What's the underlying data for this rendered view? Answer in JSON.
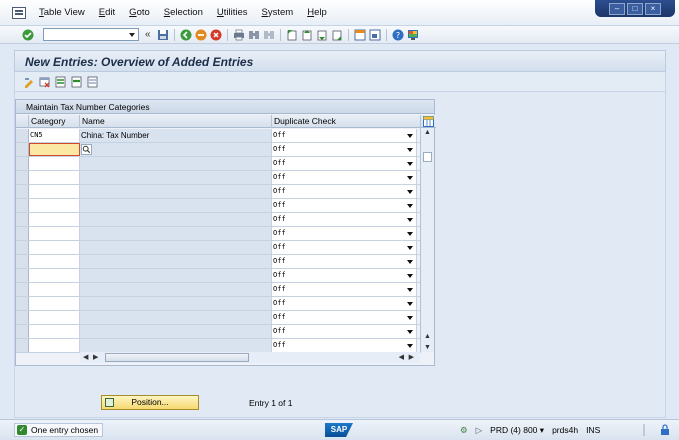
{
  "menubar": {
    "items": [
      "Table View",
      "Edit",
      "Goto",
      "Selection",
      "Utilities",
      "System",
      "Help"
    ]
  },
  "window_controls": [
    "minimize",
    "restore",
    "close"
  ],
  "toolbar": {
    "command_field_value": "",
    "icons": [
      "enter-icon",
      "save-icon",
      "back-icon",
      "exit-icon",
      "cancel-icon",
      "print-icon",
      "find-icon",
      "find-next-icon",
      "first-page-icon",
      "prev-page-icon",
      "next-page-icon",
      "last-page-icon",
      "new-session-icon",
      "shortcut-icon",
      "help-icon",
      "layout-icon"
    ]
  },
  "title": "New Entries: Overview of Added Entries",
  "app_toolbar": {
    "icons": [
      "change-display-icon",
      "delete-icon",
      "select-all-icon",
      "select-block-icon",
      "deselect-all-icon"
    ]
  },
  "table": {
    "title": "Maintain Tax Number Categories",
    "columns": [
      "Category",
      "Name",
      "Duplicate Check"
    ],
    "rows": [
      {
        "category": "CN5",
        "name": "China: Tax Number",
        "duplicate_check": "Off"
      },
      {
        "category": "",
        "name": "",
        "duplicate_check": "Off"
      },
      {
        "category": "",
        "name": "",
        "duplicate_check": "Off"
      },
      {
        "category": "",
        "name": "",
        "duplicate_check": "Off"
      },
      {
        "category": "",
        "name": "",
        "duplicate_check": "Off"
      },
      {
        "category": "",
        "name": "",
        "duplicate_check": "Off"
      },
      {
        "category": "",
        "name": "",
        "duplicate_check": "Off"
      },
      {
        "category": "",
        "name": "",
        "duplicate_check": "Off"
      },
      {
        "category": "",
        "name": "",
        "duplicate_check": "Off"
      },
      {
        "category": "",
        "name": "",
        "duplicate_check": "Off"
      },
      {
        "category": "",
        "name": "",
        "duplicate_check": "Off"
      },
      {
        "category": "",
        "name": "",
        "duplicate_check": "Off"
      },
      {
        "category": "",
        "name": "",
        "duplicate_check": "Off"
      },
      {
        "category": "",
        "name": "",
        "duplicate_check": "Off"
      },
      {
        "category": "",
        "name": "",
        "duplicate_check": "Off"
      },
      {
        "category": "",
        "name": "",
        "duplicate_check": "Off"
      }
    ]
  },
  "position_button": "Position...",
  "entry_info": "Entry 1 of 1",
  "statusbar": {
    "message": "One entry chosen",
    "logo": "SAP",
    "system": "PRD (4) 800",
    "server": "prds4h",
    "mode": "INS"
  },
  "colors": {
    "background": "#dfe9f5",
    "title_text": "#1c2e4a",
    "active_cell": "#fbe8a4",
    "active_border": "#d24a2a",
    "button_yellow": "#f5d870",
    "success_green": "#2f8a2f"
  }
}
